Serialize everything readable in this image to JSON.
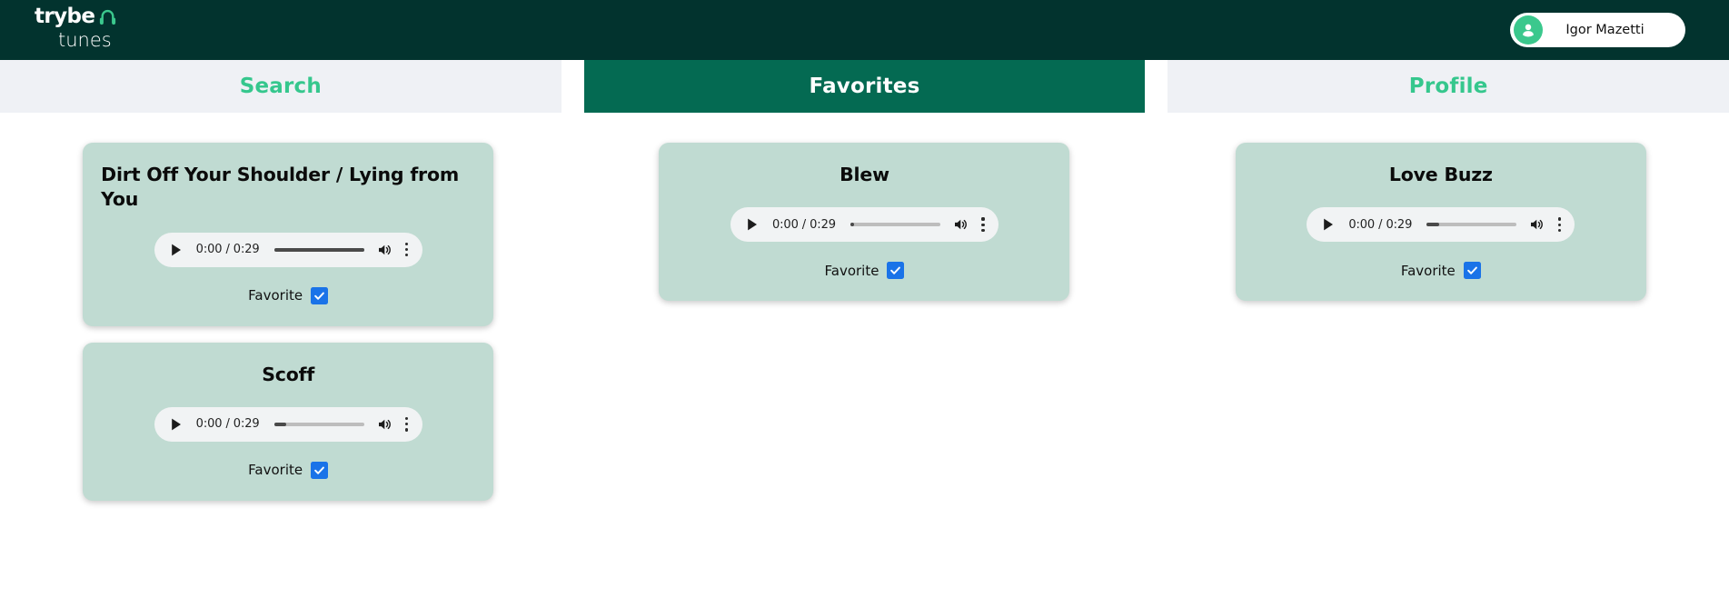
{
  "header": {
    "logo": {
      "brand_top": "trybe",
      "brand_bottom": "tunes",
      "icon": "headphones-icon"
    },
    "user": {
      "name": "Igor Mazetti",
      "avatar_icon": "user-avatar-icon"
    },
    "colors": {
      "background": "#02332e",
      "accent_green": "#3bc88d"
    }
  },
  "tabs": [
    {
      "label": "Search",
      "active": false
    },
    {
      "label": "Favorites",
      "active": true
    },
    {
      "label": "Profile",
      "active": false
    }
  ],
  "tab_colors": {
    "active_bg": "#046a52",
    "active_text": "#ffffff",
    "inactive_bg": "#eff1f5",
    "inactive_text": "#35c78d"
  },
  "card_colors": {
    "background": "#c0dbd2",
    "player_background": "#f1f3f4",
    "checkbox_checked": "#1a73e8"
  },
  "favorites_columns": [
    {
      "column": "left",
      "cards": [
        {
          "title": "Dirt Off Your Shoulder / Lying from You",
          "title_align": "left",
          "player": {
            "current_time": "0:00",
            "duration": "0:29",
            "time_display": "0:00 / 0:29",
            "progress_percent": 0,
            "buffer_state": "full",
            "play_icon": "play-icon",
            "volume_icon": "volume-icon",
            "menu_icon": "more-vertical-icon"
          },
          "favorite": {
            "label": "Favorite",
            "checked": true
          }
        },
        {
          "title": "Scoff",
          "title_align": "center",
          "player": {
            "current_time": "0:00",
            "duration": "0:29",
            "time_display": "0:00 / 0:29",
            "progress_percent": 0,
            "buffer_state": "small",
            "play_icon": "play-icon",
            "volume_icon": "volume-icon",
            "menu_icon": "more-vertical-icon"
          },
          "favorite": {
            "label": "Favorite",
            "checked": true
          }
        }
      ]
    },
    {
      "column": "middle",
      "cards": [
        {
          "title": "Blew",
          "title_align": "center",
          "player": {
            "current_time": "0:00",
            "duration": "0:29",
            "time_display": "0:00 / 0:29",
            "progress_percent": 0,
            "buffer_state": "dot",
            "play_icon": "play-icon",
            "volume_icon": "volume-icon",
            "menu_icon": "more-vertical-icon"
          },
          "favorite": {
            "label": "Favorite",
            "checked": true
          }
        }
      ]
    },
    {
      "column": "right",
      "cards": [
        {
          "title": "Love Buzz",
          "title_align": "center",
          "player": {
            "current_time": "0:00",
            "duration": "0:29",
            "time_display": "0:00 / 0:29",
            "progress_percent": 0,
            "buffer_state": "small",
            "play_icon": "play-icon",
            "volume_icon": "volume-icon",
            "menu_icon": "more-vertical-icon"
          },
          "favorite": {
            "label": "Favorite",
            "checked": true
          }
        }
      ]
    }
  ]
}
